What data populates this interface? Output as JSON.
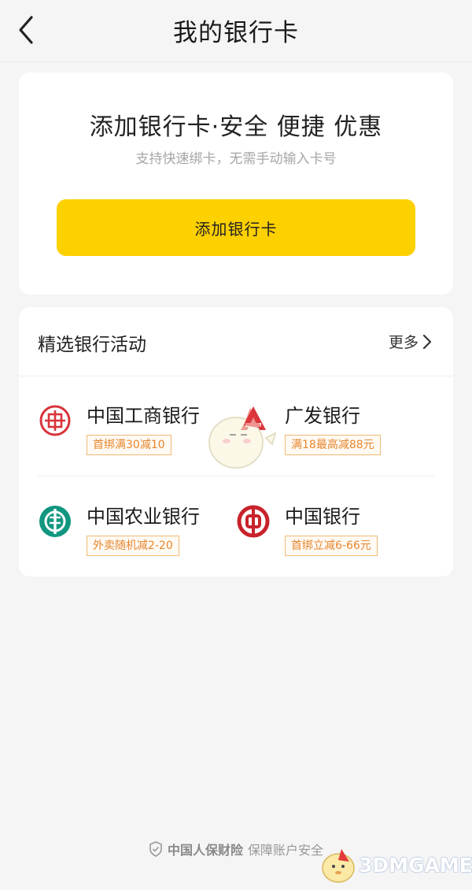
{
  "header": {
    "title": "我的银行卡",
    "back_icon": "chevron-left-icon"
  },
  "add_card": {
    "headline": "添加银行卡·安全 便捷 优惠",
    "subtitle": "支持快速绑卡，无需手动输入卡号",
    "button_label": "添加银行卡",
    "button_color": "#fdd000"
  },
  "promotions": {
    "title": "精选银行活动",
    "more_label": "更多",
    "banks": [
      {
        "name": "中国工商银行",
        "promo": "首绑满30减10",
        "logo": "icbc-logo-icon",
        "color": "#d8343b"
      },
      {
        "name": "广发银行",
        "promo": "满18最高减88元",
        "logo": "cgb-logo-icon",
        "color": "#d8343b"
      },
      {
        "name": "中国农业银行",
        "promo": "外卖随机减2-20",
        "logo": "abc-logo-icon",
        "color": "#11967f"
      },
      {
        "name": "中国银行",
        "promo": "首绑立减6-66元",
        "logo": "boc-logo-icon",
        "color": "#c8232c"
      }
    ],
    "promo_color": "#e6862e"
  },
  "footer": {
    "brand": "中国人保财险",
    "text": "保障账户安全",
    "icon": "shield-check-icon"
  },
  "watermark": {
    "text": "3DMGAME"
  }
}
